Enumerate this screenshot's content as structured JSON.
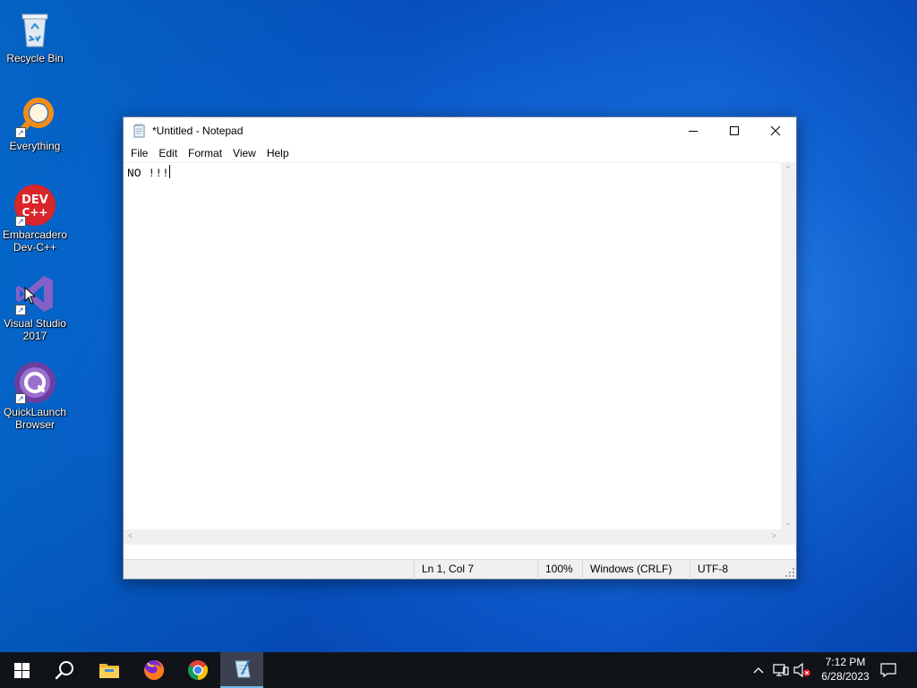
{
  "desktop": {
    "icons": [
      {
        "label": "Recycle Bin"
      },
      {
        "label": "Everything"
      },
      {
        "label": "Embarcadero Dev-C++",
        "logo": "DEV C++"
      },
      {
        "label": "Visual Studio 2017"
      },
      {
        "label": "QuickLaunch Browser"
      }
    ]
  },
  "notepad": {
    "title": "*Untitled - Notepad",
    "menu": [
      "File",
      "Edit",
      "Format",
      "View",
      "Help"
    ],
    "content": "NO !!!",
    "status": {
      "position": "Ln 1, Col 7",
      "zoom": "100%",
      "line_ending": "Windows (CRLF)",
      "encoding": "UTF-8"
    }
  },
  "taskbar": {
    "clock_time": "7:12 PM",
    "clock_date": "6/28/2023",
    "pinned": [
      "start-icon",
      "search-icon",
      "file-explorer-icon",
      "firefox-icon",
      "chrome-icon",
      "notepad-icon"
    ]
  },
  "colors": {
    "taskbar": "#101318",
    "accent": "#76b9ed"
  }
}
